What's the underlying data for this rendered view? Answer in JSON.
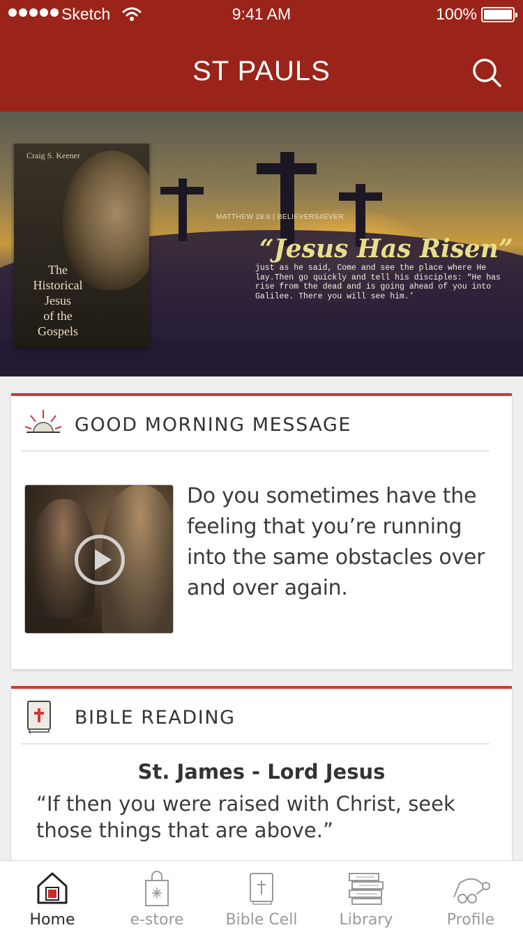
{
  "status_bar": {
    "carrier": "Sketch",
    "time": "9:41 AM",
    "battery": "100%"
  },
  "header": {
    "title": "ST PAULS",
    "search_icon": "search-icon"
  },
  "banner": {
    "book_author": "Craig S. Keener",
    "book_title": "The\nHistorical\nJesus\nof the\nGospels",
    "reference": "MATTHEW 28:6 | BELIEVERS4EVER",
    "headline": "“Jesus Has Risen”",
    "verse": "just as he said, Come and see the place where He lay.Then go quickly and tell his disciples: “He has rise from the dead and is going ahead of you into Galilee. There you will see him.’"
  },
  "cards": {
    "morning": {
      "title": "GOOD MORNING MESSAGE",
      "icon": "sunrise-icon",
      "message": "Do you sometimes have the feeling that you’re running into the same obstacles over and over again."
    },
    "bible": {
      "title": "BIBLE READING",
      "icon": "bible-icon",
      "reading_title": "St. James - Lord Jesus",
      "reading_quote": "“If then you were raised with Christ, seek those things that are above.”"
    }
  },
  "tabs": [
    {
      "label": "Home",
      "icon": "home-icon",
      "active": true
    },
    {
      "label": "e-store",
      "icon": "shopping-bag-icon",
      "active": false
    },
    {
      "label": "Bible Cell",
      "icon": "bible-icon",
      "active": false
    },
    {
      "label": "Library",
      "icon": "books-icon",
      "active": false
    },
    {
      "label": "Profile",
      "icon": "profile-icon",
      "active": false
    }
  ],
  "colors": {
    "brand": "#9a2419",
    "card_accent": "#cc3a33"
  }
}
